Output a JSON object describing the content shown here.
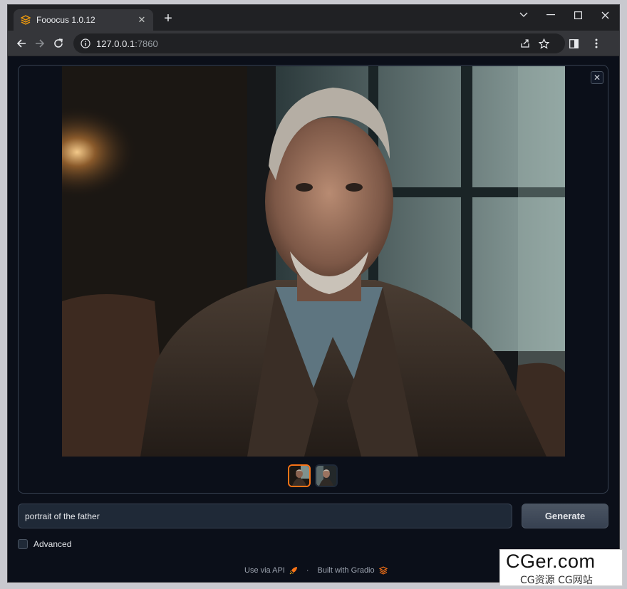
{
  "browser": {
    "tab_title": "Fooocus 1.0.12",
    "tab_close": "✕",
    "new_tab": "+",
    "url_host": "127.0.0.1",
    "url_port": ":7860"
  },
  "gallery": {
    "close_label": "✕",
    "thumbnail_count": 2,
    "selected_index": 0
  },
  "prompt": {
    "value": "portrait of the father"
  },
  "generate_label": "Generate",
  "advanced_label": "Advanced",
  "footer": {
    "api_label": "Use via API",
    "separator": "·",
    "built_label": "Built with Gradio"
  },
  "watermark": {
    "main": "CGer.com",
    "sub": "CG资源 CG网站"
  },
  "colors": {
    "accent": "#f97316",
    "page_bg": "#0b0f19",
    "panel_border": "#374151"
  }
}
